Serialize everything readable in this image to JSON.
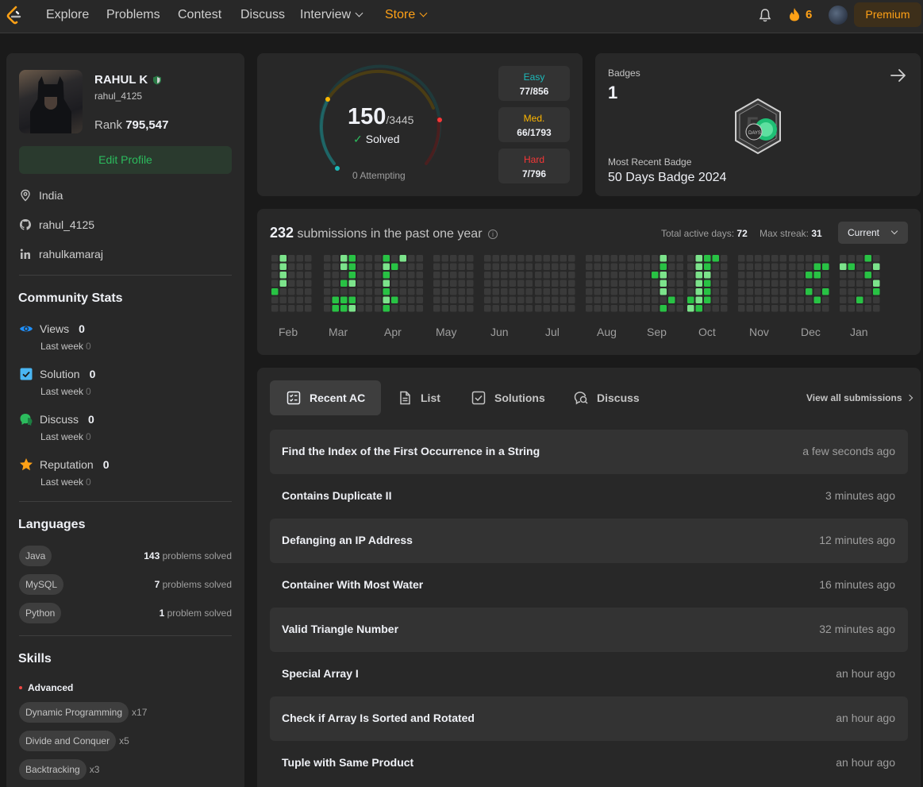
{
  "nav": {
    "items": [
      "Explore",
      "Problems",
      "Contest",
      "Discuss",
      "Interview",
      "Store"
    ],
    "streak": "6",
    "premium": "Premium"
  },
  "profile": {
    "name": "RAHUL K",
    "handle": "rahul_4125",
    "rank_label": "Rank",
    "rank": "795,547",
    "edit": "Edit Profile",
    "location": "India",
    "github": "rahul_4125",
    "linkedin": "rahulkamaraj"
  },
  "community": {
    "title": "Community Stats",
    "last_week_label": "Last week",
    "stats": [
      {
        "label": "Views",
        "value": "0",
        "last_week": "0"
      },
      {
        "label": "Solution",
        "value": "0",
        "last_week": "0"
      },
      {
        "label": "Discuss",
        "value": "0",
        "last_week": "0"
      },
      {
        "label": "Reputation",
        "value": "0",
        "last_week": "0"
      }
    ]
  },
  "languages": {
    "title": "Languages",
    "items": [
      {
        "name": "Java",
        "count": "143",
        "suffix": "problems solved"
      },
      {
        "name": "MySQL",
        "count": "7",
        "suffix": "problems solved"
      },
      {
        "name": "Python",
        "count": "1",
        "suffix": "problem solved"
      }
    ]
  },
  "skills": {
    "title": "Skills",
    "level": "Advanced",
    "items": [
      {
        "name": "Dynamic Programming",
        "count": "x17"
      },
      {
        "name": "Divide and Conquer",
        "count": "x5"
      },
      {
        "name": "Backtracking",
        "count": "x3"
      }
    ]
  },
  "solved": {
    "count": "150",
    "total": "/3445",
    "label": "Solved",
    "attempting": "0 Attempting",
    "difficulty": [
      {
        "name": "Easy",
        "value": "77/856",
        "color": "#1cbaba"
      },
      {
        "name": "Med.",
        "value": "66/1793",
        "color": "#ffb700"
      },
      {
        "name": "Hard",
        "value": "7/796",
        "color": "#f63737"
      }
    ]
  },
  "badges": {
    "label": "Badges",
    "count": "1",
    "badge_text": "DAYS",
    "recent_label": "Most Recent Badge",
    "recent_name": "50 Days Badge 2024"
  },
  "heatmap": {
    "count": "232",
    "title_suffix": "submissions in the past one year",
    "active_label": "Total active days:",
    "active_days": "72",
    "streak_label": "Max streak:",
    "max_streak": "31",
    "selector": "Current",
    "months": [
      "Feb",
      "Mar",
      "Apr",
      "May",
      "Jun",
      "Jul",
      "Aug",
      "Sep",
      "Oct",
      "Nov",
      "Dec",
      "Jan"
    ]
  },
  "submissions": {
    "tabs": [
      "Recent AC",
      "List",
      "Solutions",
      "Discuss"
    ],
    "view_all": "View all submissions",
    "rows": [
      {
        "title": "Find the Index of the First Occurrence in a String",
        "time": "a few seconds ago"
      },
      {
        "title": "Contains Duplicate II",
        "time": "3 minutes ago"
      },
      {
        "title": "Defanging an IP Address",
        "time": "12 minutes ago"
      },
      {
        "title": "Container With Most Water",
        "time": "16 minutes ago"
      },
      {
        "title": "Valid Triangle Number",
        "time": "32 minutes ago"
      },
      {
        "title": "Special Array I",
        "time": "an hour ago"
      },
      {
        "title": "Check if Array Is Sorted and Rotated",
        "time": "an hour ago"
      },
      {
        "title": "Tuple with Same Product",
        "time": "an hour ago"
      }
    ]
  }
}
